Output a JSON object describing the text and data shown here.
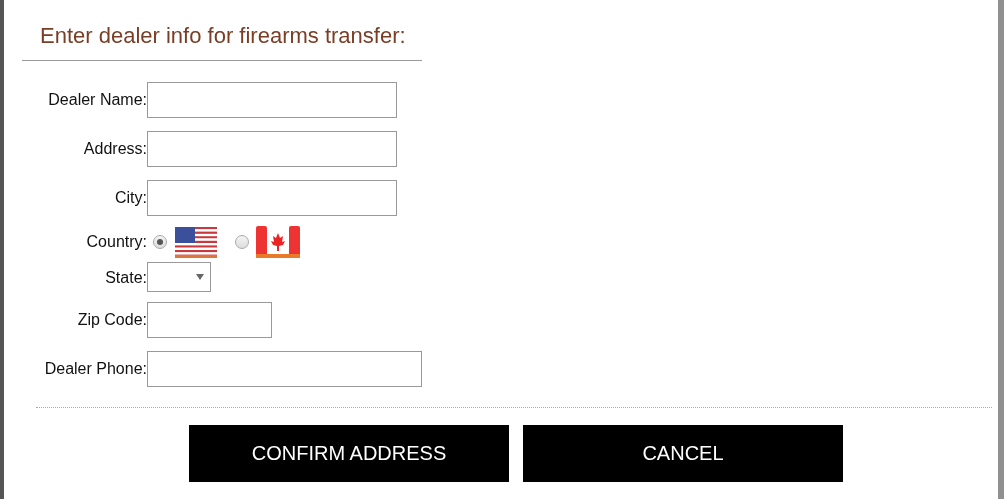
{
  "dialog": {
    "title": "Enter dealer info for firearms transfer:",
    "fields": [
      {
        "kind": "text",
        "label": "Dealer Name:"
      },
      {
        "kind": "text",
        "label": "Address:"
      },
      {
        "kind": "text",
        "label": "City:"
      },
      {
        "kind": "radio",
        "label": "Country:",
        "options": [
          {
            "kind": "usflag",
            "selected": true
          },
          {
            "kind": "caflag",
            "selected": false
          }
        ]
      },
      {
        "kind": "select",
        "label": "State:"
      },
      {
        "kind": "shorttext",
        "label": "Zip Code:"
      },
      {
        "kind": "longtext",
        "label": "Dealer Phone:"
      }
    ],
    "buttons": [
      "CONFIRM ADDRESS",
      "CANCEL"
    ]
  }
}
